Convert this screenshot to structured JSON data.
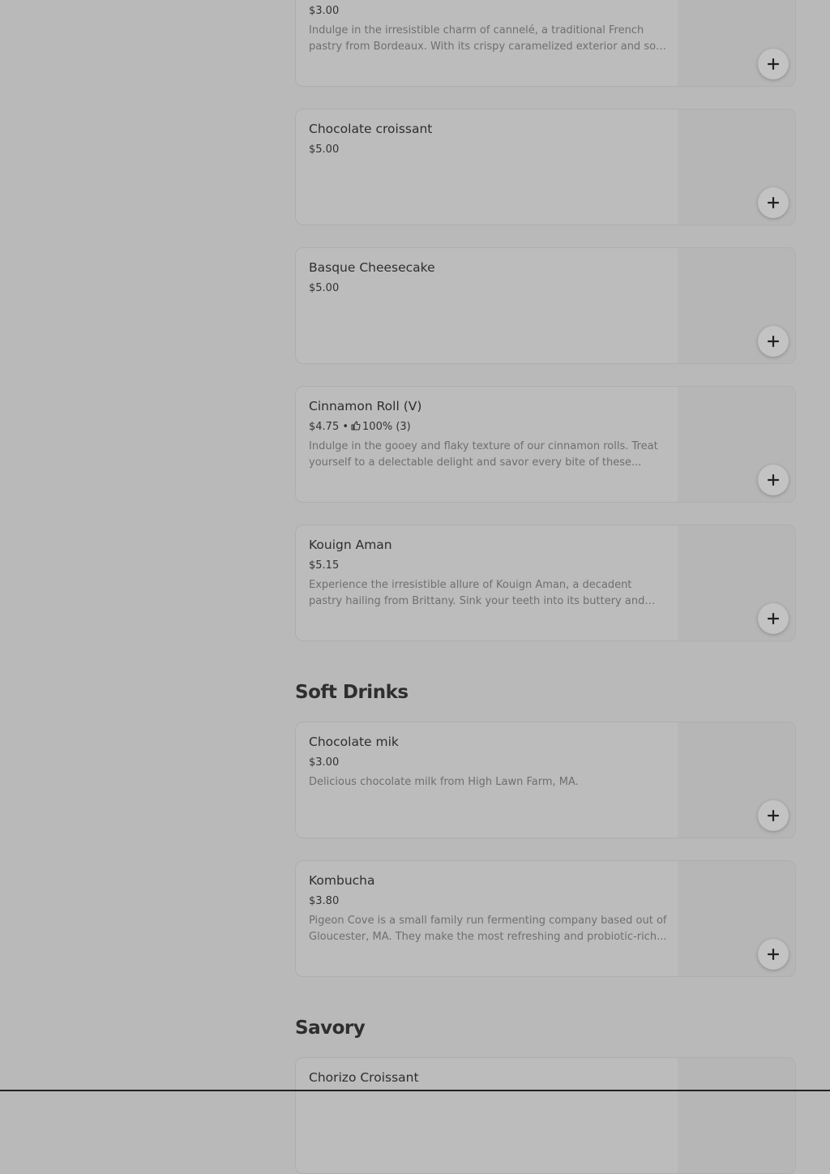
{
  "items": [
    {
      "price": "$3.00",
      "description": "Indulge in the irresistible charm of cannelé, a traditional French pastry from Bordeaux. With its crispy caramelized exterior and soft, custardy interior."
    },
    {
      "name": "Chocolate croissant",
      "price": "$5.00"
    },
    {
      "name": "Basque Cheesecake",
      "price": "$5.00"
    },
    {
      "name": "Cinnamon Roll (V)",
      "price": "$4.75",
      "separator": "•",
      "rating": "100%",
      "rating_count": "(3)",
      "rating_icon": "thumbs-up-icon",
      "description": "Indulge in the gooey and flaky texture of our cinnamon rolls. Treat yourself to a delectable delight and savor every bite of these..."
    },
    {
      "name": "Kouign Aman",
      "price": "$5.15",
      "description": "Experience the irresistible allure of Kouign Aman, a decadent pastry hailing from Brittany. Sink your teeth into its buttery and flaky layers..."
    }
  ],
  "sections": [
    {
      "title": "Soft Drinks",
      "items": [
        {
          "name": "Chocolate mik",
          "price": "$3.00",
          "description": "Delicious chocolate milk from High Lawn Farm, MA."
        },
        {
          "name": "Kombucha",
          "price": "$3.80",
          "description": "Pigeon Cove is a small family run fermenting company based out of Gloucester, MA. They make the most refreshing and probiotic-rich..."
        }
      ]
    },
    {
      "title": "Savory",
      "items": [
        {
          "name": "Chorizo Croissant"
        }
      ]
    }
  ],
  "icons": {
    "add": "plus-icon",
    "rating": "thumbs-up-icon"
  }
}
